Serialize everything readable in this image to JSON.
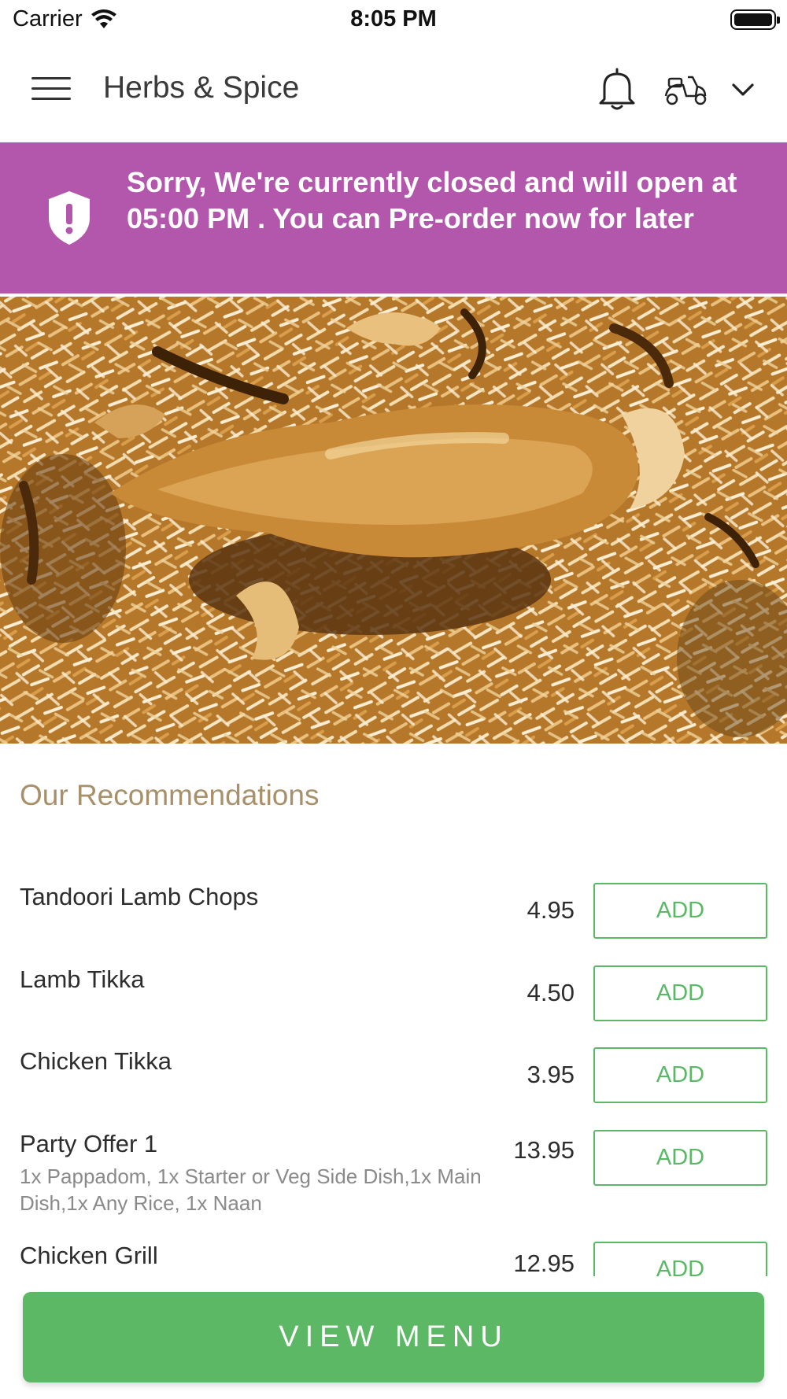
{
  "status_bar": {
    "carrier": "Carrier",
    "time": "8:05 PM"
  },
  "header": {
    "title": "Herbs & Spice",
    "icons": [
      "hamburger-menu-icon",
      "bell-icon",
      "delivery-scooter-icon",
      "chevron-down-icon"
    ]
  },
  "banner": {
    "message": "Sorry, We're currently closed and will open at 05:00 PM . You can Pre-order now for later",
    "color": "#b357ad",
    "icon": "shield-alert-icon"
  },
  "recommendations": {
    "title": "Our Recommendations",
    "add_label": "ADD",
    "items": [
      {
        "name": "Tandoori Lamb Chops",
        "description": "",
        "price": "4.95"
      },
      {
        "name": "Lamb Tikka",
        "description": "",
        "price": "4.50"
      },
      {
        "name": "Chicken Tikka",
        "description": "",
        "price": "3.95"
      },
      {
        "name": "Party Offer 1",
        "description": "1x Pappadom, 1x Starter or Veg Side Dish,1x Main Dish,1x Any Rice, 1x Naan",
        "price": "13.95"
      },
      {
        "name": "Chicken Grill",
        "description": "",
        "price": "12.95"
      }
    ]
  },
  "footer": {
    "view_menu_label": "VIEW MENU",
    "accent_color": "#5cb865"
  }
}
